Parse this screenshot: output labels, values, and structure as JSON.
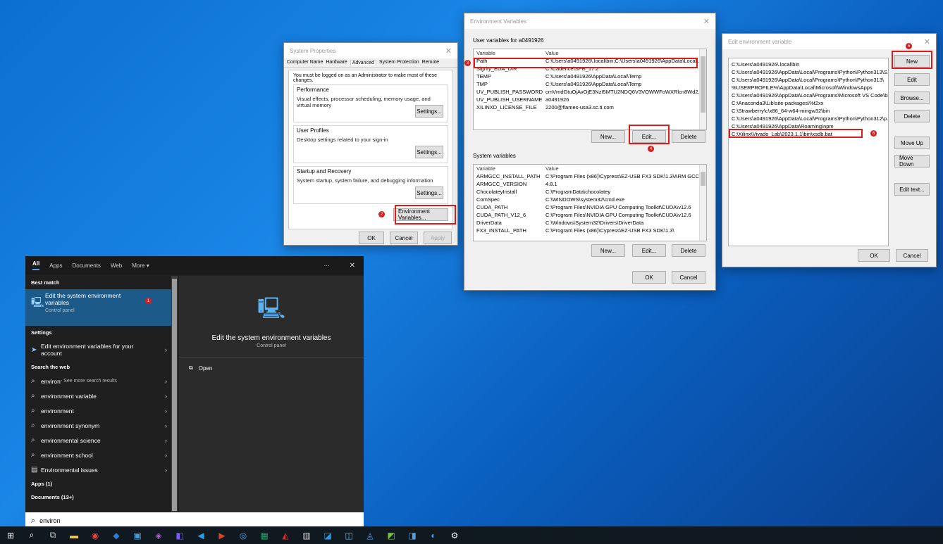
{
  "system_properties": {
    "title": "System Properties",
    "tabs": [
      "Computer Name",
      "Hardware",
      "Advanced",
      "System Protection",
      "Remote"
    ],
    "admin_note": "You must be logged on as an Administrator to make most of these changes.",
    "performance": {
      "title": "Performance",
      "text": "Visual effects, processor scheduling, memory usage, and virtual memory",
      "button": "Settings..."
    },
    "user_profiles": {
      "title": "User Profiles",
      "text": "Desktop settings related to your sign-in",
      "button": "Settings..."
    },
    "startup": {
      "title": "Startup and Recovery",
      "text": "System startup, system failure, and debugging information",
      "button": "Settings..."
    },
    "env_button": "Environment Variables...",
    "ok": "OK",
    "cancel": "Cancel",
    "apply": "Apply",
    "marker": "2"
  },
  "env_vars": {
    "title": "Environment Variables",
    "user_section": "User variables for a0491926",
    "col_variable": "Variable",
    "col_value": "Value",
    "user_vars": [
      {
        "name": "Path",
        "value": "C:\\Users\\a0491926\\.local\\bin;C:\\Users\\a0491926\\AppData\\Local..."
      },
      {
        "name": "Sigrity_EDA_DIR",
        "value": "C:\\Cadence\\SPB_17.2"
      },
      {
        "name": "TEMP",
        "value": "C:\\Users\\a0491926\\AppData\\Local\\Temp"
      },
      {
        "name": "TMP",
        "value": "C:\\Users\\a0491926\\AppData\\Local\\Temp"
      },
      {
        "name": "UV_PUBLISH_PASSWORD",
        "value": "cmVmdGtuOjAvOjE3NzI5MTU2NDQ6V3VOWWFoWXRlcn8Wd2..."
      },
      {
        "name": "UV_PUBLISH_USERNAME",
        "value": "a0491926"
      },
      {
        "name": "XILINXD_LICENSE_FILE",
        "value": "2200@flames-usa3.sc.ti.com"
      }
    ],
    "user_buttons": {
      "new": "New...",
      "edit": "Edit...",
      "delete": "Delete"
    },
    "system_section": "System variables",
    "system_vars": [
      {
        "name": "ARMGCC_INSTALL_PATH",
        "value": "C:\\Program Files (x86)\\Cypress\\EZ-USB FX3 SDK\\1.3\\ARM GCC\\"
      },
      {
        "name": "ARMGCC_VERSION",
        "value": "4.8.1"
      },
      {
        "name": "ChocolateyInstall",
        "value": "C:\\ProgramData\\chocolatey"
      },
      {
        "name": "ComSpec",
        "value": "C:\\WINDOWS\\system32\\cmd.exe"
      },
      {
        "name": "CUDA_PATH",
        "value": "C:\\Program Files\\NVIDIA GPU Computing Toolkit\\CUDA\\v12.6"
      },
      {
        "name": "CUDA_PATH_V12_6",
        "value": "C:\\Program Files\\NVIDIA GPU Computing Toolkit\\CUDA\\v12.6"
      },
      {
        "name": "DriverData",
        "value": "C:\\Windows\\System32\\Drivers\\DriverData"
      },
      {
        "name": "FX3_INSTALL_PATH",
        "value": "C:\\Program Files (x86)\\Cypress\\EZ-USB FX3 SDK\\1.3\\"
      }
    ],
    "system_buttons": {
      "new": "New...",
      "edit": "Edit...",
      "delete": "Delete"
    },
    "ok": "OK",
    "cancel": "Cancel",
    "marker_path": "3",
    "marker_edit": "4"
  },
  "edit_env": {
    "title": "Edit environment variable",
    "entries": [
      "C:\\Users\\a0491926\\.local\\bin",
      "C:\\Users\\a0491926\\AppData\\Local\\Programs\\Python\\Python313\\S...",
      "C:\\Users\\a0491926\\AppData\\Local\\Programs\\Python\\Python313\\",
      "%USERPROFILE%\\AppData\\Local\\Microsoft\\WindowsApps",
      "C:\\Users\\a0491926\\AppData\\Local\\Programs\\Microsoft VS Code\\bin",
      "C:\\Anaconda3\\Lib\\site-packages\\%t2xx",
      "C:\\Strawberry\\c\\x86_64-w64-mingw32\\bin",
      "C:\\Users\\a0491926\\AppData\\Local\\Programs\\Python\\Python312\\p...",
      "C:\\Users\\a0491926\\AppData\\Roaming\\npm",
      "C:\\Xilinx\\Vivado_Lab\\2023.1.1\\bin\\xsdb.bat"
    ],
    "buttons": [
      "New",
      "Edit",
      "Browse...",
      "Delete",
      "Move Up",
      "Move Down",
      "Edit text..."
    ],
    "ok": "OK",
    "cancel": "Cancel",
    "marker_new": "5",
    "marker_entry": "6"
  },
  "search": {
    "tabs": [
      "All",
      "Apps",
      "Documents",
      "Web",
      "More ▾"
    ],
    "best_match_label": "Best match",
    "best_title": "Edit the system environment variables",
    "best_sub": "Control panel",
    "marker": "1",
    "settings_label": "Settings",
    "settings_item": "Edit environment variables for your account",
    "web_label": "Search the web",
    "web_items": [
      {
        "text": "environ",
        "sub": " - See more search results"
      },
      {
        "text": "environment variable",
        "sub": ""
      },
      {
        "text": "environment",
        "sub": ""
      },
      {
        "text": "environment synonym",
        "sub": ""
      },
      {
        "text": "environmental science",
        "sub": ""
      },
      {
        "text": "environment school",
        "sub": ""
      },
      {
        "text": "Environmental issues",
        "sub": ""
      }
    ],
    "apps_label": "Apps (1)",
    "docs_label": "Documents (13+)",
    "preview_title": "Edit the system environment variables",
    "preview_sub": "Control panel",
    "open_label": "Open",
    "query": "environ",
    "more_dots": "···",
    "close": "✕"
  },
  "taskbar": {
    "icons": [
      "windows-start",
      "search",
      "task-view",
      "file-explorer",
      "chrome",
      "outlook",
      "photos",
      "app1",
      "app2",
      "vscode",
      "powerpoint",
      "maps",
      "excel",
      "acrobat",
      "calculator",
      "app3",
      "app4",
      "app5",
      "app6",
      "app7",
      "app8",
      "settings"
    ]
  },
  "colors": {
    "accent_red": "#e01a1a",
    "desktop_blue": "#0a6fd0",
    "search_bg": "#1f1f1f",
    "selection_blue": "#1c5a8a"
  }
}
